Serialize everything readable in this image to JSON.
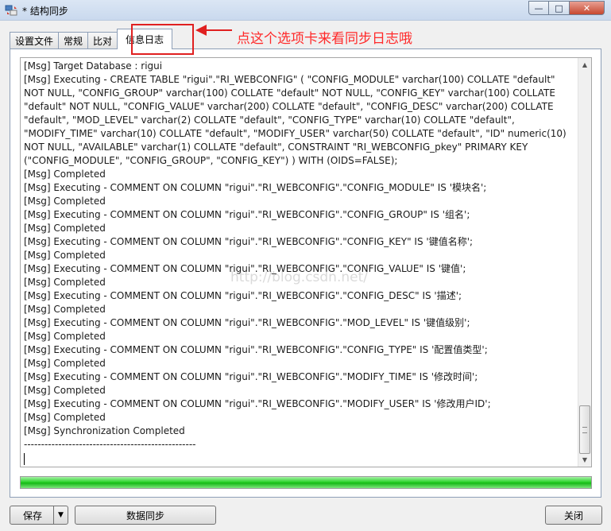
{
  "window": {
    "title": "* 结构同步",
    "minimize_glyph": "—",
    "maximize_glyph": "□",
    "close_glyph": "✕"
  },
  "tabs": [
    {
      "label": "设置文件"
    },
    {
      "label": "常规"
    },
    {
      "label": "比对"
    },
    {
      "label": "信息日志",
      "active": true
    }
  ],
  "annotation": {
    "text": "点这个选项卡来看同步日志哦",
    "color": "#ff2a2a"
  },
  "watermark": "http://blog.csdn.net/",
  "log": {
    "lines": [
      "[Msg] Target Database : rigui",
      "[Msg] Executing - CREATE TABLE \"rigui\".\"RI_WEBCONFIG\" ( \"CONFIG_MODULE\" varchar(100) COLLATE \"default\" NOT NULL, \"CONFIG_GROUP\" varchar(100) COLLATE \"default\" NOT NULL, \"CONFIG_KEY\" varchar(100) COLLATE \"default\" NOT NULL, \"CONFIG_VALUE\" varchar(200) COLLATE \"default\", \"CONFIG_DESC\" varchar(200) COLLATE \"default\", \"MOD_LEVEL\" varchar(2) COLLATE \"default\", \"CONFIG_TYPE\" varchar(10) COLLATE \"default\", \"MODIFY_TIME\" varchar(10) COLLATE \"default\", \"MODIFY_USER\" varchar(50) COLLATE \"default\", \"ID\" numeric(10) NOT NULL, \"AVAILABLE\" varchar(1) COLLATE \"default\", CONSTRAINT \"RI_WEBCONFIG_pkey\" PRIMARY KEY (\"CONFIG_MODULE\", \"CONFIG_GROUP\", \"CONFIG_KEY\") ) WITH (OIDS=FALSE);",
      "[Msg] Completed",
      "[Msg] Executing - COMMENT ON COLUMN \"rigui\".\"RI_WEBCONFIG\".\"CONFIG_MODULE\" IS '模块名';",
      "[Msg] Completed",
      "[Msg] Executing - COMMENT ON COLUMN \"rigui\".\"RI_WEBCONFIG\".\"CONFIG_GROUP\" IS '组名';",
      "[Msg] Completed",
      "[Msg] Executing - COMMENT ON COLUMN \"rigui\".\"RI_WEBCONFIG\".\"CONFIG_KEY\" IS '键值名称';",
      "[Msg] Completed",
      "[Msg] Executing - COMMENT ON COLUMN \"rigui\".\"RI_WEBCONFIG\".\"CONFIG_VALUE\" IS '键值';",
      "[Msg] Completed",
      "[Msg] Executing - COMMENT ON COLUMN \"rigui\".\"RI_WEBCONFIG\".\"CONFIG_DESC\" IS '描述';",
      "[Msg] Completed",
      "[Msg] Executing - COMMENT ON COLUMN \"rigui\".\"RI_WEBCONFIG\".\"MOD_LEVEL\" IS '键值级别';",
      "[Msg] Completed",
      "[Msg] Executing - COMMENT ON COLUMN \"rigui\".\"RI_WEBCONFIG\".\"CONFIG_TYPE\" IS '配置值类型';",
      "[Msg] Completed",
      "[Msg] Executing - COMMENT ON COLUMN \"rigui\".\"RI_WEBCONFIG\".\"MODIFY_TIME\" IS '修改时间';",
      "[Msg] Completed",
      "[Msg] Executing - COMMENT ON COLUMN \"rigui\".\"RI_WEBCONFIG\".\"MODIFY_USER\" IS '修改用户ID';",
      "[Msg] Completed",
      "[Msg] Synchronization Completed",
      "--------------------------------------------------"
    ]
  },
  "progress": {
    "percent": 100
  },
  "buttons": {
    "save_label": "保存",
    "save_dropdown_glyph": "▼",
    "sync_label": "数据同步",
    "close_label": "关闭"
  },
  "scrollbar": {
    "up_glyph": "▲",
    "down_glyph": "▼"
  },
  "colors": {
    "progress_green": "#16b916",
    "highlight_red": "#e02020"
  }
}
